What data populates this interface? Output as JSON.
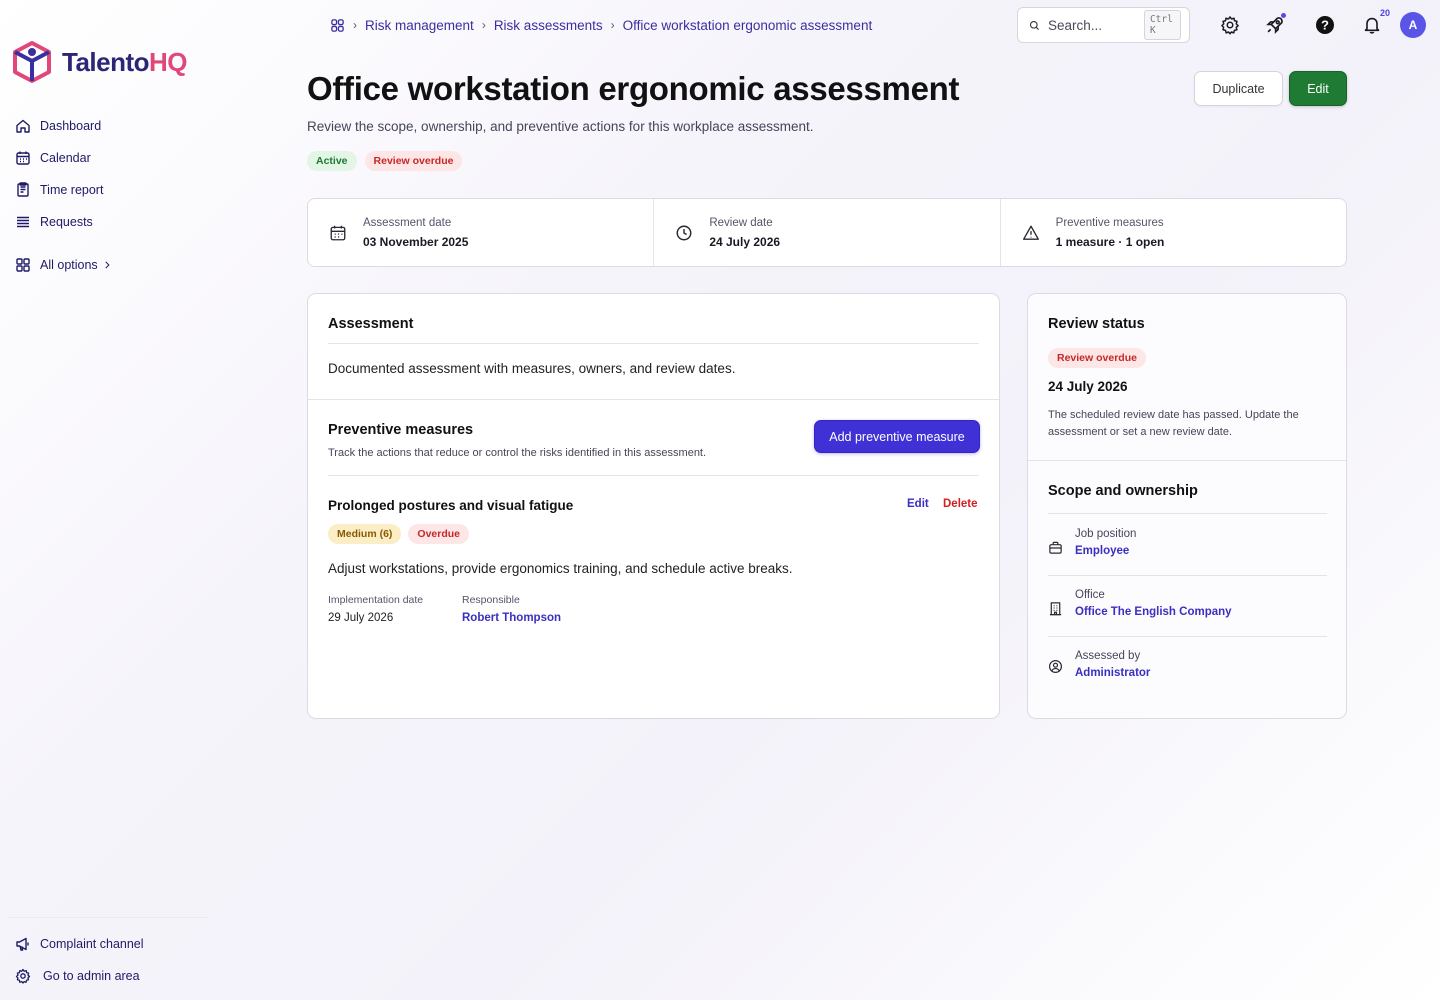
{
  "app": {
    "name_main": "Talento",
    "name_accent": "HQ"
  },
  "sidebar": {
    "items": [
      {
        "label": "Dashboard",
        "icon": "home-icon"
      },
      {
        "label": "Calendar",
        "icon": "calendar-icon"
      },
      {
        "label": "Time report",
        "icon": "report-icon"
      },
      {
        "label": "Requests",
        "icon": "list-icon"
      }
    ],
    "all_options": "All options",
    "bottom": [
      {
        "label": "Complaint channel",
        "icon": "megaphone-icon"
      },
      {
        "label": "Go to admin area",
        "icon": "gear-icon"
      }
    ]
  },
  "breadcrumb": [
    "Risk management",
    "Risk assessments",
    "Office workstation ergonomic assessment"
  ],
  "search": {
    "placeholder": "Search...",
    "shortcut": "Ctrl K"
  },
  "topbar": {
    "notifications_count": "20",
    "avatar_initial": "A"
  },
  "header": {
    "title": "Office workstation ergonomic assessment",
    "subtitle": "Review the scope, ownership, and preventive actions for this workplace assessment.",
    "badges": [
      "Active",
      "Review overdue"
    ],
    "duplicate_label": "Duplicate",
    "edit_label": "Edit"
  },
  "stats": [
    {
      "label": "Assessment date",
      "value": "03 November 2025",
      "icon": "calendar-icon"
    },
    {
      "label": "Review date",
      "value": "24 July 2026",
      "icon": "clock-icon"
    },
    {
      "label": "Preventive measures",
      "value": "1 measure · 1 open",
      "icon": "warning-icon"
    }
  ],
  "assessment": {
    "title": "Assessment",
    "description": "Documented assessment with measures, owners, and review dates."
  },
  "measures": {
    "title": "Preventive measures",
    "subtitle": "Track the actions that reduce or control the risks identified in this assessment.",
    "add_label": "Add preventive measure",
    "items": [
      {
        "title": "Prolonged postures and visual fatigue",
        "edit_label": "Edit",
        "delete_label": "Delete",
        "risk_badge": "Medium (6)",
        "status_badge": "Overdue",
        "description": "Adjust workstations, provide ergonomics training, and schedule active breaks.",
        "impl_label": "Implementation date",
        "impl_value": "29 July 2026",
        "resp_label": "Responsible",
        "resp_value": "Robert Thompson"
      }
    ]
  },
  "review": {
    "title": "Review status",
    "badge": "Review overdue",
    "date": "24 July 2026",
    "note": "The scheduled review date has passed. Update the assessment or set a new review date."
  },
  "scope": {
    "title": "Scope and ownership",
    "rows": [
      {
        "label": "Job position",
        "value": "Employee",
        "icon": "briefcase-icon"
      },
      {
        "label": "Office",
        "value": "Office The English Company",
        "icon": "building-icon"
      },
      {
        "label": "Assessed by",
        "value": "Administrator",
        "icon": "user-circle-icon"
      }
    ]
  }
}
